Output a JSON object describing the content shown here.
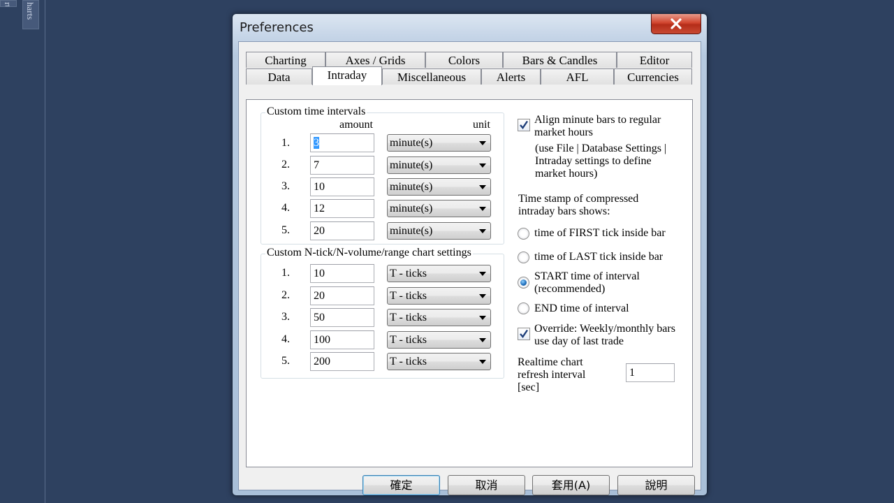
{
  "background": {
    "vertical_tab_1": "rts",
    "vertical_tab_2": "harts"
  },
  "window": {
    "title": "Preferences"
  },
  "tabs": {
    "row1": [
      "Charting",
      "Axes / Grids",
      "Colors",
      "Bars & Candles",
      "Editor"
    ],
    "row2": [
      "Data",
      "Intraday",
      "Miscellaneous",
      "Alerts",
      "AFL",
      "Currencies"
    ],
    "active": "Intraday"
  },
  "custom_time_intervals": {
    "legend": "Custom time intervals",
    "amount_header": "amount",
    "unit_header": "unit",
    "rows": [
      {
        "num": "1.",
        "amount": "3",
        "unit": "minute(s)"
      },
      {
        "num": "2.",
        "amount": "7",
        "unit": "minute(s)"
      },
      {
        "num": "3.",
        "amount": "10",
        "unit": "minute(s)"
      },
      {
        "num": "4.",
        "amount": "12",
        "unit": "minute(s)"
      },
      {
        "num": "5.",
        "amount": "20",
        "unit": "minute(s)"
      }
    ]
  },
  "custom_ntick": {
    "legend": "Custom N-tick/N-volume/range chart settings",
    "rows": [
      {
        "num": "1.",
        "amount": "10",
        "unit": "T - ticks"
      },
      {
        "num": "2.",
        "amount": "20",
        "unit": "T - ticks"
      },
      {
        "num": "3.",
        "amount": "50",
        "unit": "T - ticks"
      },
      {
        "num": "4.",
        "amount": "100",
        "unit": "T - ticks"
      },
      {
        "num": "5.",
        "amount": "200",
        "unit": "T - ticks"
      }
    ]
  },
  "right": {
    "align_checkbox": {
      "line1": "Align minute bars to regular",
      "line2": "market hours",
      "checked": true
    },
    "align_note": [
      "(use File | Database Settings |",
      "Intraday settings to define",
      "market hours)"
    ],
    "timestamp_label": [
      "Time stamp of compressed",
      "intraday bars shows:"
    ],
    "radios": [
      {
        "line1": "time of FIRST tick inside bar",
        "line2": "",
        "selected": false
      },
      {
        "line1": "time of LAST tick inside bar",
        "line2": "",
        "selected": false
      },
      {
        "line1": "START time of interval",
        "line2": "(recommended)",
        "selected": true
      },
      {
        "line1": "END time of interval",
        "line2": "",
        "selected": false
      }
    ],
    "override_checkbox": {
      "line1": "Override: Weekly/monthly bars",
      "line2": "use day of last trade",
      "checked": true
    },
    "refresh_label": [
      "Realtime chart",
      "refresh interval",
      "[sec]"
    ],
    "refresh_value": "1"
  },
  "buttons": {
    "ok": "確定",
    "cancel": "取消",
    "apply": "套用(A)",
    "help": "說明"
  },
  "colors": {
    "desktop": "#2e4160",
    "close_button": "#c9412b",
    "selection": "#3399ff",
    "radio_selected": "#1b6ab8"
  }
}
